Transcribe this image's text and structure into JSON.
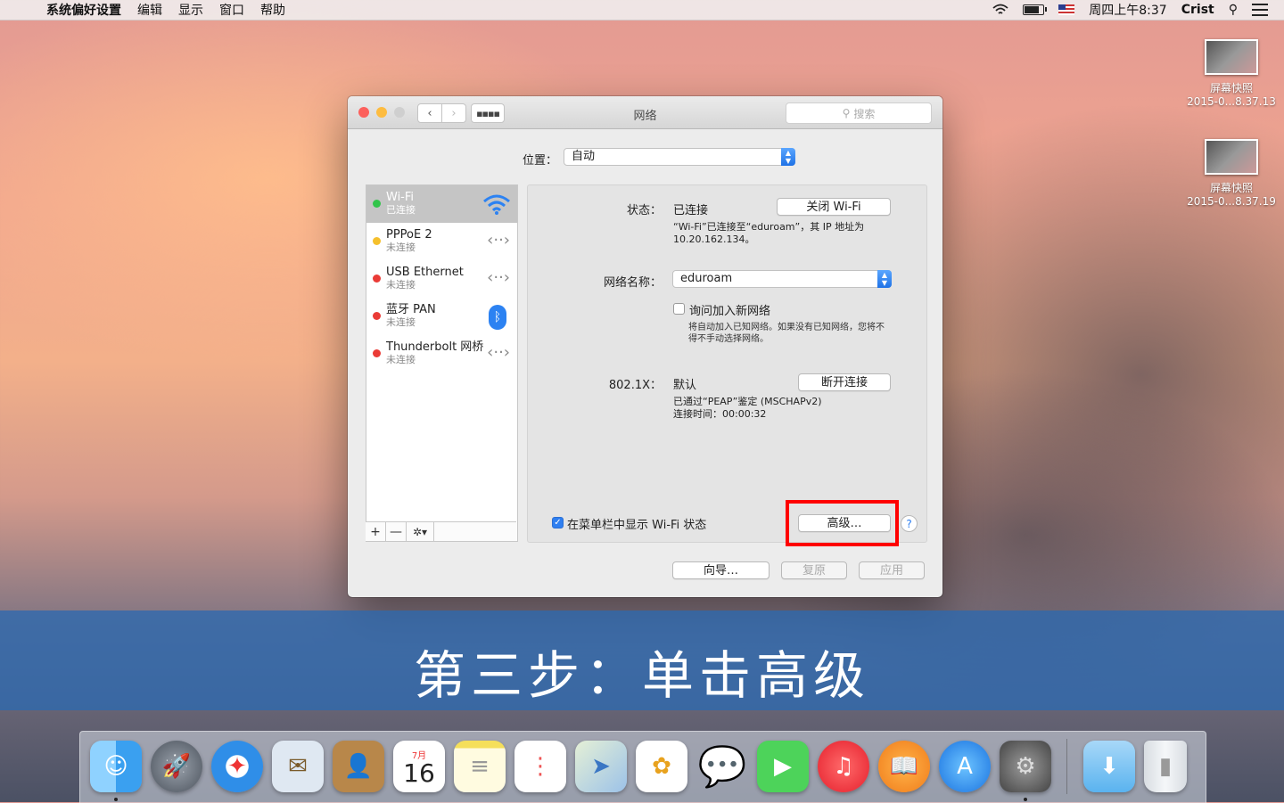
{
  "menubar": {
    "app_name": "系统偏好设置",
    "menus": [
      "编辑",
      "显示",
      "窗口",
      "帮助"
    ],
    "clock": "周四上午8:37",
    "user": "Crist"
  },
  "desktop": {
    "files": [
      {
        "name": "屏幕快照",
        "date": "2015-0...8.37.13"
      },
      {
        "name": "屏幕快照",
        "date": "2015-0...8.37.19"
      }
    ]
  },
  "window": {
    "title": "网络",
    "search_placeholder": "搜索",
    "location_label": "位置：",
    "location_value": "自动"
  },
  "services": [
    {
      "name": "Wi-Fi",
      "status": "已连接",
      "dot": "#32c44a",
      "icon": "wifi-icon",
      "selected": true
    },
    {
      "name": "PPPoE 2",
      "status": "未连接",
      "dot": "#f5c02c",
      "icon": "ethernet-icon"
    },
    {
      "name": "USB Ethernet",
      "status": "未连接",
      "dot": "#ea3b36",
      "icon": "ethernet-icon"
    },
    {
      "name": "蓝牙 PAN",
      "status": "未连接",
      "dot": "#ea3b36",
      "icon": "bluetooth-icon"
    },
    {
      "name": "Thunderbolt 网桥",
      "status": "未连接",
      "dot": "#ea3b36",
      "icon": "ethernet-icon"
    }
  ],
  "sidebar_tools": {
    "add": "+",
    "remove": "—",
    "gear": "✲▾"
  },
  "detail": {
    "status_label": "状态：",
    "status_value": "已连接",
    "turn_off_button": "关闭 Wi-Fi",
    "status_desc_line1": "“Wi-Fi”已连接至“eduroam”，其 IP 地址为",
    "status_desc_line2": "10.20.162.134。",
    "network_label": "网络名称：",
    "network_value": "eduroam",
    "ask_join_label": "询问加入新网络",
    "ask_join_desc_line1": "将自动加入已知网络。如果没有已知网络，您将不",
    "ask_join_desc_line2": "得不手动选择网络。",
    "dot1x_label": "802.1X：",
    "dot1x_value": "默认",
    "disconnect_button": "断开连接",
    "dot1x_desc_line1": "已通过“PEAP”鉴定 (MSCHAPv2)",
    "dot1x_desc_line2": "连接时间：00:00:32",
    "show_menubar_label": "在菜单栏中显示 Wi-Fi 状态",
    "advanced_button": "高级…",
    "help_button": "?"
  },
  "footer": {
    "assist_button": "向导…",
    "revert_button": "复原",
    "apply_button": "应用"
  },
  "caption": "第三步：单击高级",
  "colors": {
    "highlight_box": "#ff0000",
    "caption_band": "#2d69af",
    "accent": "#2f7ff0"
  },
  "dock": [
    "Finder",
    "Launchpad",
    "Safari",
    "Mail",
    "通讯录",
    "日历",
    "备忘录",
    "提醒事项",
    "地图",
    "照片",
    "信息",
    "FaceTime",
    "iTunes",
    "iBooks",
    "App Store",
    "系统偏好设置",
    "下载",
    "废纸篓"
  ],
  "calendar_icon": {
    "month": "7月",
    "day": "16"
  }
}
